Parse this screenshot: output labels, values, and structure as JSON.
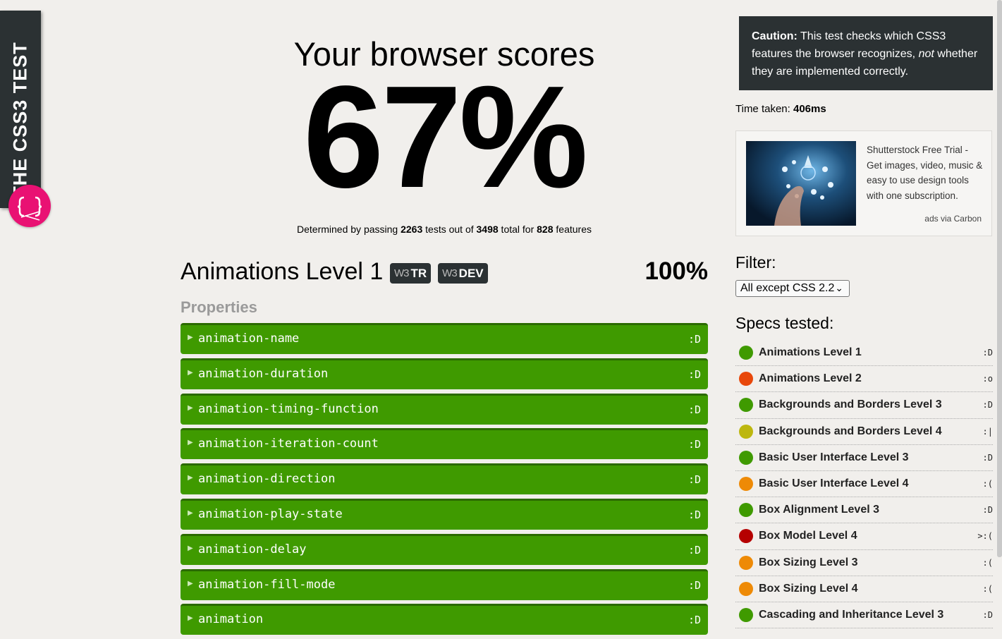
{
  "ribbon": {
    "title": "THE CSS3 TEST",
    "logo_icon": "css3-logo-icon"
  },
  "hero": {
    "title": "Your browser scores",
    "score": "67%",
    "sub_prefix": "Determined by passing ",
    "passed": "2263",
    "sub_mid1": " tests out of ",
    "total": "3498",
    "sub_mid2": " total for ",
    "features": "828",
    "sub_suffix": " features"
  },
  "spec": {
    "name": "Animations Level 1",
    "badge_tr": "TR",
    "badge_dev": "DEV",
    "badge_w3": "W3",
    "score": "100%",
    "section_label": "Properties",
    "properties": [
      {
        "name": "animation-name",
        "result": ":D"
      },
      {
        "name": "animation-duration",
        "result": ":D"
      },
      {
        "name": "animation-timing-function",
        "result": ":D"
      },
      {
        "name": "animation-iteration-count",
        "result": ":D"
      },
      {
        "name": "animation-direction",
        "result": ":D"
      },
      {
        "name": "animation-play-state",
        "result": ":D"
      },
      {
        "name": "animation-delay",
        "result": ":D"
      },
      {
        "name": "animation-fill-mode",
        "result": ":D"
      },
      {
        "name": "animation",
        "result": ":D"
      }
    ],
    "pass_color": "#3f9a00"
  },
  "sidebar": {
    "caution_label": "Caution:",
    "caution_text1": " This test checks which CSS3 features the browser recognizes, ",
    "caution_em": "not",
    "caution_text2": " whether they are implemented correctly.",
    "time_label": "Time taken: ",
    "time_value": "406ms",
    "ad_text": "Shutterstock Free Trial - Get images, video, music & easy to use design tools with one subscription.",
    "ad_via": "ads via Carbon",
    "filter_label": "Filter:",
    "filter_value": "All except CSS 2.2",
    "specs_label": "Specs tested:",
    "specs": [
      {
        "name": "Animations Level 1",
        "result": ":D",
        "color": "#3f9a00"
      },
      {
        "name": "Animations Level 2",
        "result": ":o",
        "color": "#e8470a"
      },
      {
        "name": "Backgrounds and Borders Level 3",
        "result": ":D",
        "color": "#3f9a00"
      },
      {
        "name": "Backgrounds and Borders Level 4",
        "result": ":|",
        "color": "#bdb70f"
      },
      {
        "name": "Basic User Interface Level 3",
        "result": ":D",
        "color": "#3f9a00"
      },
      {
        "name": "Basic User Interface Level 4",
        "result": ":(",
        "color": "#ee8a06"
      },
      {
        "name": "Box Alignment Level 3",
        "result": ":D",
        "color": "#3f9a00"
      },
      {
        "name": "Box Model Level 4",
        "result": ">:(",
        "color": "#b50000"
      },
      {
        "name": "Box Sizing Level 3",
        "result": ":(",
        "color": "#ee8a06"
      },
      {
        "name": "Box Sizing Level 4",
        "result": ":(",
        "color": "#ee8a06"
      },
      {
        "name": "Cascading and Inheritance Level 3",
        "result": ":D",
        "color": "#3f9a00"
      }
    ]
  }
}
